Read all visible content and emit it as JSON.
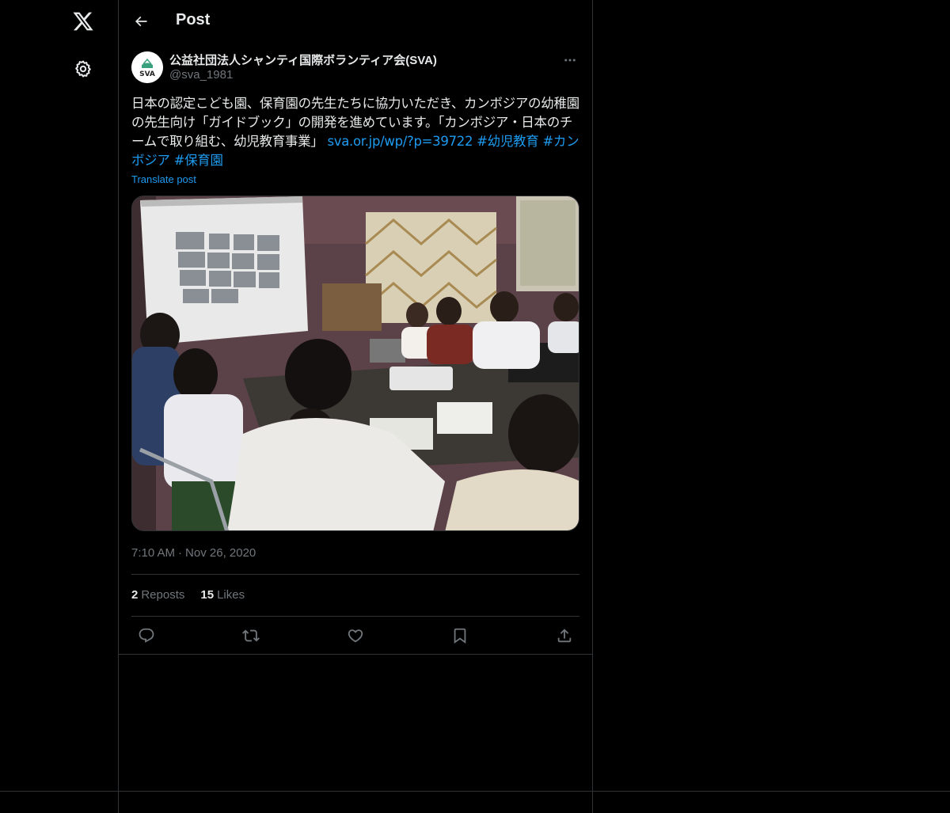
{
  "header": {
    "title": "Post",
    "back_icon": "arrow-left-icon"
  },
  "rail": {
    "logo_icon": "x-logo-icon",
    "settings_icon": "gear-icon"
  },
  "post": {
    "author_name": "公益社団法人シャンティ国際ボランティア会(SVA)",
    "author_handle": "@sva_1981",
    "avatar_text": "SVA",
    "text_main": "日本の認定こども園、保育園の先生たちに協力いただき、カンボジアの幼稚園の先生向け「ガイドブック」の開発を進めています。「カンボジア・日本のチームで取り組む、幼児教育事業」 ",
    "link": "sva.or.jp/wp/?p=39722",
    "hashtags": [
      "#幼児教育",
      "#カンボジア",
      "#保育園"
    ],
    "translate_label": "Translate post",
    "time": "7:10 AM",
    "separator": "·",
    "date": "Nov 26, 2020",
    "reposts_count": "2",
    "reposts_label": "Reposts",
    "likes_count": "15",
    "likes_label": "Likes"
  },
  "actions": [
    "reply-icon",
    "repost-icon",
    "like-icon",
    "bookmark-icon",
    "share-icon"
  ],
  "colors": {
    "background": "#000000",
    "text": "#e7e9ea",
    "muted": "#71767b",
    "accent": "#1d9bf0",
    "border": "#2f3336"
  }
}
